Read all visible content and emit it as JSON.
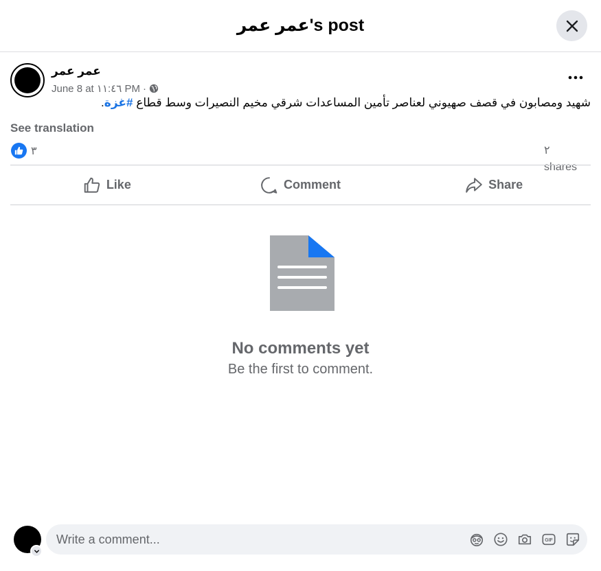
{
  "header": {
    "title": "عمر عمر's post"
  },
  "post": {
    "author": "عمر عمر",
    "timestamp": "June 8 at ١١:٤٦ PM",
    "separator": "·",
    "text_main": "شهيد ومصابون في قصف صهيوني لعناصر تأمين المساعدات شرقي مخيم النصيرات وسط قطاع ",
    "hashtag": "#غزة",
    "text_end": ".",
    "see_translation": "See translation",
    "reaction_count": "٣",
    "shares_count": "٢",
    "shares_label": "shares"
  },
  "actions": {
    "like": "Like",
    "comment": "Comment",
    "share": "Share"
  },
  "comments_empty": {
    "title": "No comments yet",
    "subtitle": "Be the first to comment."
  },
  "composer": {
    "placeholder": "Write a comment..."
  },
  "icons": {
    "close": "close-icon",
    "more": "more-icon",
    "globe": "globe-icon",
    "like": "thumbs-up-icon",
    "comment": "comment-bubble-icon",
    "share": "share-arrow-icon",
    "avatar_sticker": "avatar-sticker-icon",
    "emoji": "emoji-icon",
    "camera": "camera-icon",
    "gif": "gif-icon",
    "sticker": "sticker-icon"
  },
  "colors": {
    "accent": "#1877f2",
    "hashtag": "#1b74e4",
    "secondary_text": "#65676b",
    "composer_bg": "#f0f2f5"
  }
}
